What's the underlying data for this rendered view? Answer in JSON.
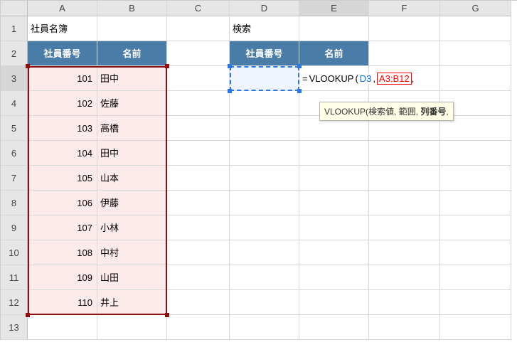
{
  "corner": "",
  "cols": [
    "A",
    "B",
    "C",
    "D",
    "E",
    "F",
    "G"
  ],
  "rows": [
    "1",
    "2",
    "3",
    "4",
    "5",
    "6",
    "7",
    "8",
    "9",
    "10",
    "11",
    "12",
    "13"
  ],
  "a1": "社員名簿",
  "d1": "検索",
  "header_id": "社員番号",
  "header_name": "名前",
  "table": [
    {
      "id": "101",
      "name": "田中"
    },
    {
      "id": "102",
      "name": "佐藤"
    },
    {
      "id": "103",
      "name": "高橋"
    },
    {
      "id": "104",
      "name": "田中"
    },
    {
      "id": "105",
      "name": "山本"
    },
    {
      "id": "106",
      "name": "伊藤"
    },
    {
      "id": "107",
      "name": "小林"
    },
    {
      "id": "108",
      "name": "中村"
    },
    {
      "id": "109",
      "name": "山田"
    },
    {
      "id": "110",
      "name": "井上"
    }
  ],
  "formula": {
    "eq": "=",
    "fn": "VLOOKUP",
    "open": "(",
    "arg1": "D3",
    "comma1": ",",
    "arg2": "A3:B12",
    "comma2": ","
  },
  "hint": {
    "fn": "VLOOKUP(",
    "a": "検索値",
    "b": "範囲",
    "c": "列番号",
    "tail": ","
  }
}
